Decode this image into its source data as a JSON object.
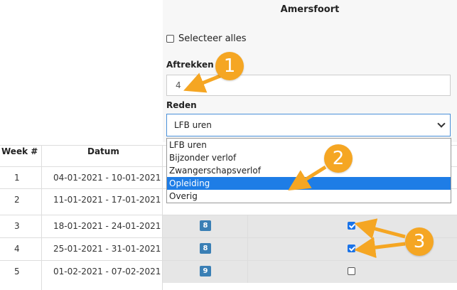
{
  "panel": {
    "title": "Amersfoort",
    "select_all_label": "Selecteer alles",
    "aftrekken_label": "Aftrekken",
    "aftrekken_value": "4",
    "reden_label": "Reden",
    "reden_selected": "LFB uren"
  },
  "dropdown": {
    "options": [
      "LFB uren",
      "Bijzonder verlof",
      "Zwangerschapsverlof",
      "Opleiding",
      "Overig"
    ],
    "highlighted": "Opleiding"
  },
  "table": {
    "headers": {
      "week": "Week #",
      "datum": "Datum"
    },
    "rows": [
      {
        "week": "1",
        "datum": "04-01-2021 - 10-01-2021",
        "badge": "",
        "checked": false
      },
      {
        "week": "2",
        "datum": "11-01-2021 - 17-01-2021",
        "badge": "",
        "checked": false
      },
      {
        "week": "3",
        "datum": "18-01-2021 - 24-01-2021",
        "badge": "8",
        "checked": true
      },
      {
        "week": "4",
        "datum": "25-01-2021 - 31-01-2021",
        "badge": "8",
        "checked": true
      },
      {
        "week": "5",
        "datum": "01-02-2021 - 07-02-2021",
        "badge": "9",
        "checked": false
      }
    ]
  },
  "callouts": [
    "1",
    "2",
    "3"
  ],
  "colors": {
    "callout": "#f5a623",
    "badge": "#3a7fb5",
    "highlight": "#1e7de6",
    "checkbox": "#1a73e8"
  }
}
